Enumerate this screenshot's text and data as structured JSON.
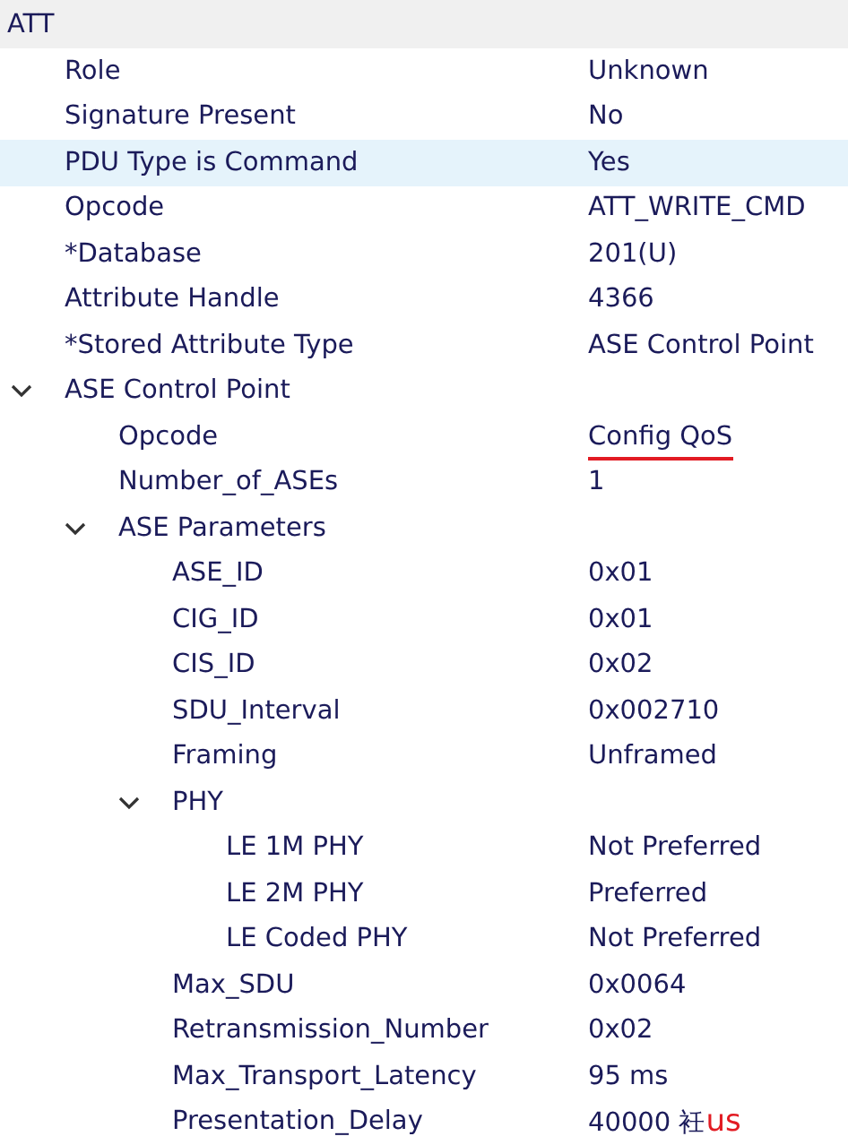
{
  "header": {
    "title": "ATT"
  },
  "items": [
    {
      "name": "Role",
      "value": "Unknown",
      "selected": false
    },
    {
      "name": "Signature Present",
      "value": "No",
      "selected": false
    },
    {
      "name": "PDU Type is Command",
      "value": "Yes",
      "selected": true
    },
    {
      "name": "Opcode",
      "value": "ATT_WRITE_CMD",
      "selected": false
    },
    {
      "name": "*Database",
      "value": "201(U)",
      "selected": false
    },
    {
      "name": "Attribute Handle",
      "value": "4366",
      "selected": false
    },
    {
      "name": "*Stored Attribute Type",
      "value": "ASE Control Point",
      "selected": false
    },
    {
      "name": "ASE Control Point",
      "selected": false,
      "expanded": true,
      "children": [
        {
          "name": "Opcode",
          "value": "Config QoS",
          "selected": false,
          "underlined": true
        },
        {
          "name": "Number_of_ASEs",
          "value": "1",
          "selected": false
        },
        {
          "name": "ASE Parameters",
          "selected": false,
          "expanded": true,
          "children": [
            {
              "name": "ASE_ID",
              "value": "0x01",
              "selected": false
            },
            {
              "name": "CIG_ID",
              "value": "0x01",
              "selected": false
            },
            {
              "name": "CIS_ID",
              "value": "0x02",
              "selected": false
            },
            {
              "name": "SDU_Interval",
              "value": "0x002710",
              "selected": false
            },
            {
              "name": "Framing",
              "value": "Unframed",
              "selected": false
            },
            {
              "name": "PHY",
              "selected": false,
              "expanded": true,
              "children": [
                {
                  "name": "LE 1M PHY",
                  "value": "Not Preferred",
                  "selected": false
                },
                {
                  "name": "LE 2M PHY",
                  "value": "Preferred",
                  "selected": false
                },
                {
                  "name": "LE Coded PHY",
                  "value": "Not Preferred",
                  "selected": false
                }
              ]
            },
            {
              "name": "Max_SDU",
              "value": "0x0064",
              "selected": false
            },
            {
              "name": "Retransmission_Number",
              "value": "0x02",
              "selected": false
            },
            {
              "name": "Max_Transport_Latency",
              "value": "95 ms",
              "selected": false
            },
            {
              "name": "Presentation_Delay",
              "value": "40000 衽",
              "selected": false,
              "annotation": "us"
            }
          ]
        }
      ]
    }
  ]
}
